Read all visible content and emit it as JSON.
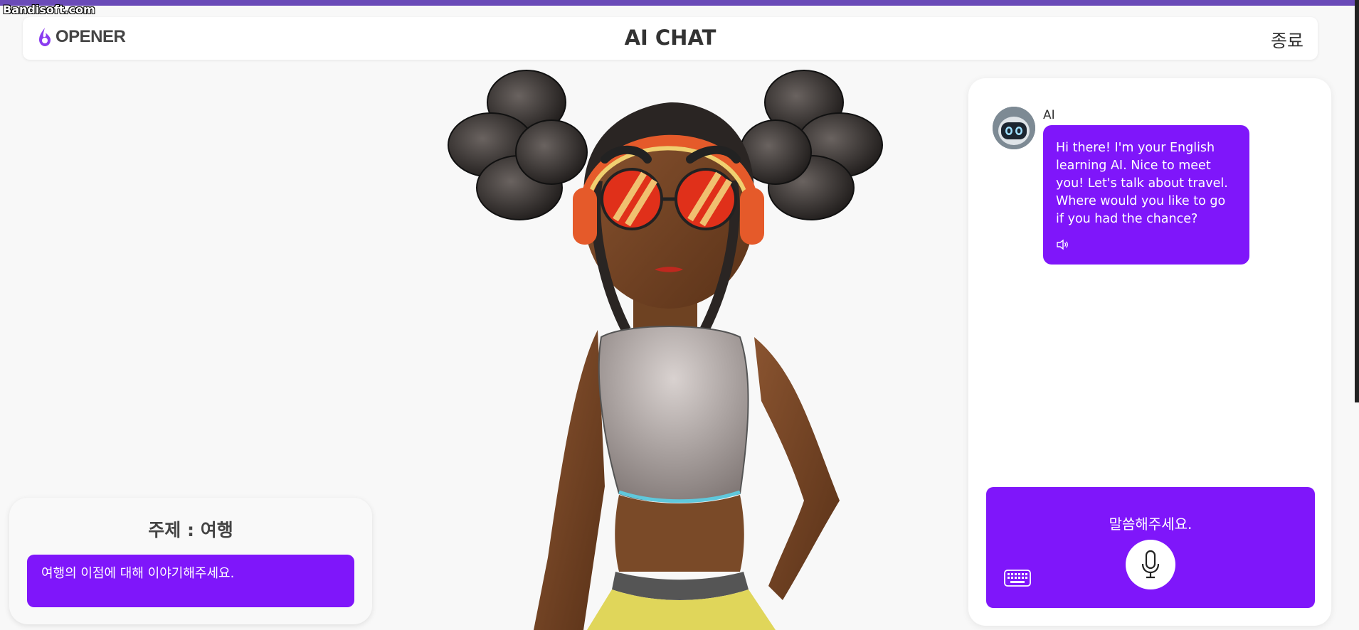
{
  "watermark": "Bandisoft.com",
  "header": {
    "logo_text": "OPENER",
    "title": "AI CHAT",
    "exit_label": "종료"
  },
  "topic": {
    "title": "주제 : 여행",
    "question": "여행의 이점에 대해 이야기해주세요."
  },
  "chat": {
    "messages": [
      {
        "sender": "AI",
        "text": "Hi there! I'm your English learning AI. Nice to meet you! Let's talk about travel. Where would you like to go if you had the chance?",
        "icon": "speaker-icon"
      }
    ]
  },
  "voice": {
    "prompt": "말씀해주세요.",
    "mic_icon": "microphone-icon",
    "keyboard_icon": "keyboard-icon"
  },
  "colors": {
    "accent": "#7f16fa",
    "top_line": "#6a4bb8",
    "background": "#f8f8f8"
  }
}
